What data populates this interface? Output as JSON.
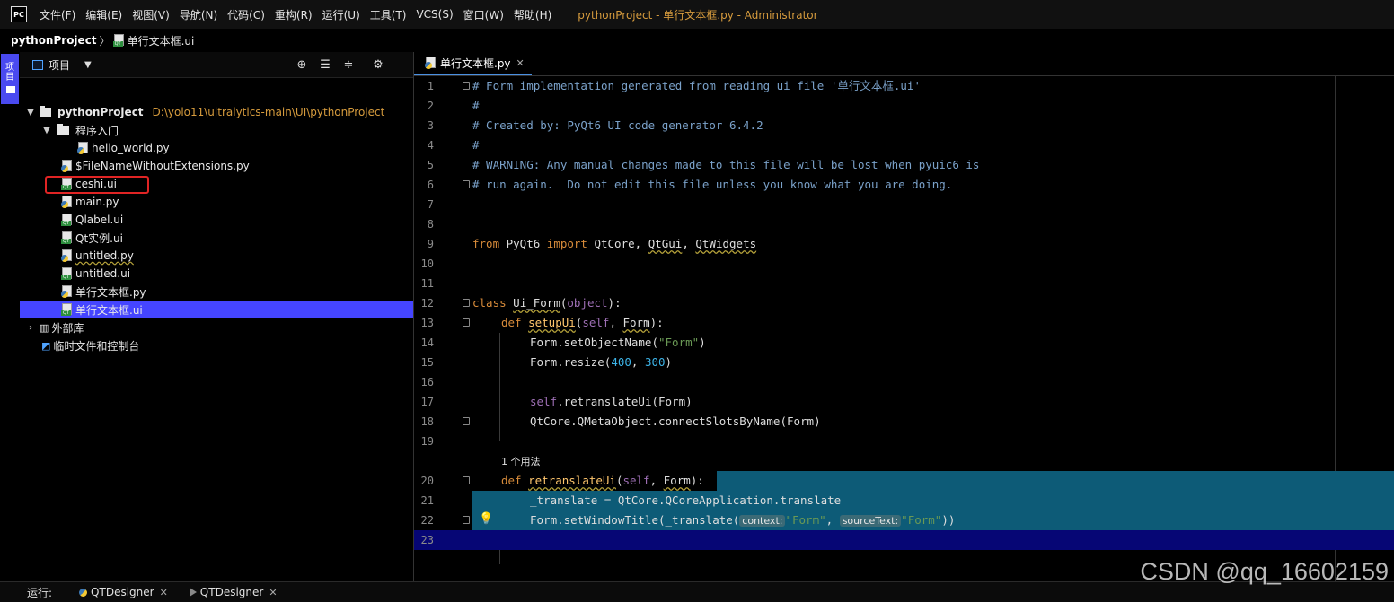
{
  "menubar": {
    "logo": "PC",
    "items": [
      "文件(F)",
      "编辑(E)",
      "视图(V)",
      "导航(N)",
      "代码(C)",
      "重构(R)",
      "运行(U)",
      "工具(T)",
      "VCS(S)",
      "窗口(W)",
      "帮助(H)"
    ],
    "window_title": "pythonProject - 单行文本框.py - Administrator"
  },
  "breadcrumb": {
    "project": "pythonProject",
    "separator": "〉",
    "file": "单行文本框.ui"
  },
  "tool_strip": {
    "project_label": "项目"
  },
  "project_panel": {
    "title": "项目",
    "dropdown": "▼"
  },
  "tree": {
    "root": {
      "label": "pythonProject",
      "path": "D:\\yolo11\\ultralytics-main\\UI\\pythonProject"
    },
    "folder": {
      "label": "程序入门"
    },
    "items": [
      {
        "label": "hello_world.py"
      },
      {
        "label": "$FileNameWithoutExtensions.py"
      },
      {
        "label": "ceshi.ui"
      },
      {
        "label": "main.py"
      },
      {
        "label": "Qlabel.ui"
      },
      {
        "label": "Qt实例.ui"
      },
      {
        "label": "untitled.py"
      },
      {
        "label": "untitled.ui"
      },
      {
        "label": "单行文本框.py"
      },
      {
        "label": "单行文本框.ui"
      }
    ],
    "external": {
      "label": "外部库"
    },
    "scratches": {
      "label": "临时文件和控制台"
    }
  },
  "editor": {
    "tab_label": "单行文本框.py",
    "tab_close": "✕",
    "usages": "1 个用法",
    "line_numbers": [
      "1",
      "2",
      "3",
      "4",
      "5",
      "6",
      "7",
      "8",
      "9",
      "10",
      "11",
      "12",
      "13",
      "14",
      "15",
      "16",
      "17",
      "18",
      "19",
      "20",
      "21",
      "22",
      "23"
    ],
    "code": {
      "l1": "# Form implementation generated from reading ui file '单行文本框.ui'",
      "l2": "#",
      "l3": "# Created by: PyQt6 UI code generator 6.4.2",
      "l4": "#",
      "l5": "# WARNING: Any manual changes made to this file will be lost when pyuic6 is",
      "l6": "# run again.  Do not edit this file unless you know what you are doing.",
      "l9_from": "from",
      "l9_mod": " PyQt6 ",
      "l9_import": "import",
      "l9_rest1": " QtCore, ",
      "l9_gui": "QtGui",
      "l9_comma": ", ",
      "l9_widgets": "QtWidgets",
      "l12_class": "class",
      "l12_name": "Ui_Form",
      "l12_open": "(",
      "l12_obj": "object",
      "l12_close": "):",
      "l13_def": "def",
      "l13_fn": "setupUi",
      "l13_open": "(",
      "l13_self": "self",
      "l13_rest": ", ",
      "l13_form": "Form",
      "l13_close": "):",
      "l14_a": "Form.setObjectName(",
      "l14_s": "\"Form\"",
      "l14_b": ")",
      "l15_a": "Form.resize(",
      "l15_n1": "400",
      "l15_c": ", ",
      "l15_n2": "300",
      "l15_b": ")",
      "l17_self": "self",
      "l17_rest": ".retranslateUi(Form)",
      "l18": "QtCore.QMetaObject.connectSlotsByName(Form)",
      "l20_def": "def",
      "l20_fn": "retranslateUi",
      "l20_open": "(",
      "l20_self": "self",
      "l20_rest": ", ",
      "l20_form": "Form",
      "l20_close": "):",
      "l21": "_translate = QtCore.QCoreApplication.translate",
      "l22_a": "Form.setWindowTitle(_translate(",
      "l22_h1": "context:",
      "l22_s1": "\"Form\"",
      "l22_c": ", ",
      "l22_h2": "sourceText:",
      "l22_s2": "\"Form\"",
      "l22_b": "))"
    }
  },
  "runbar": {
    "label": "运行:",
    "tabs": [
      {
        "label": "QTDesigner"
      },
      {
        "label": "QTDesigner"
      }
    ],
    "close": "✕"
  },
  "watermark": "CSDN @qq_16602159",
  "colors": {
    "selection": "#4545ff",
    "highlight_box": "#e02424",
    "code_selection": "#0d5b77",
    "current_line": "#060675"
  }
}
